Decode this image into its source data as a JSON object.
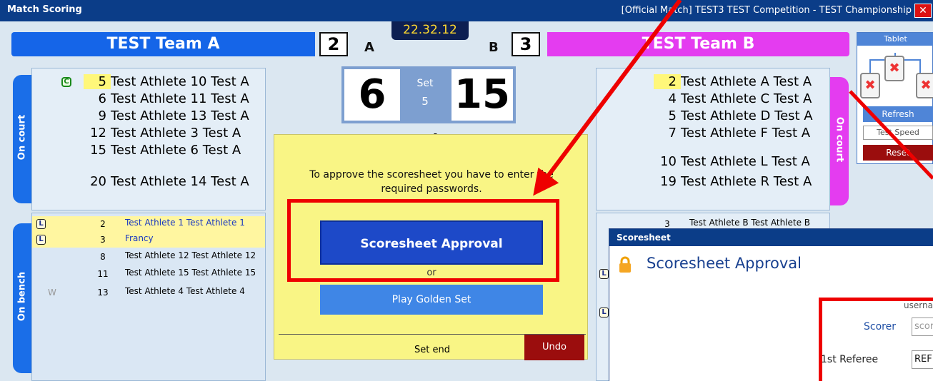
{
  "window": {
    "title": "Match Scoring",
    "match_info": "[Official Match] TEST3  TEST Competition - TEST Championship",
    "close_glyph": "✕"
  },
  "clock": "22.32.12",
  "teamA": {
    "name": "TEST Team A",
    "sets": "2",
    "side": "A"
  },
  "teamB": {
    "name": "TEST Team B",
    "sets": "3",
    "side": "B"
  },
  "set_score": {
    "pointsA": "6",
    "pointsB": "15",
    "label": "Set",
    "number": "5"
  },
  "separator_glyph": ":",
  "labels": {
    "on_court": "On court",
    "on_bench": "On bench"
  },
  "teamA_court": [
    {
      "num": "5",
      "name": "Test Athlete 10 Test A",
      "highlight": true
    },
    {
      "num": "6",
      "name": "Test Athlete 11 Test A"
    },
    {
      "num": "9",
      "name": "Test Athlete 13 Test A"
    },
    {
      "num": "12",
      "name": "Test Athlete 3 Test A"
    },
    {
      "num": "15",
      "name": "Test Athlete 6 Test A"
    },
    {
      "num": "20",
      "name": "Test Athlete 14 Test A"
    }
  ],
  "captain_glyph": "C",
  "teamA_bench": [
    {
      "libero": "L",
      "num": "2",
      "name": "Test Athlete 1 Test Athlete 1",
      "highlight": true
    },
    {
      "libero": "L",
      "num": "3",
      "name": "Francy",
      "highlight": true
    },
    {
      "num": "8",
      "name": "Test Athlete 12 Test Athlete 12"
    },
    {
      "num": "11",
      "name": "Test Athlete 15 Test Athlete 15"
    },
    {
      "num": "13",
      "name": "Test Athlete 4 Test Athlete 4",
      "mark": "W"
    }
  ],
  "teamB_court": [
    {
      "num": "2",
      "name": "Test Athlete A Test A",
      "highlight": true
    },
    {
      "num": "4",
      "name": "Test Athlete C Test A"
    },
    {
      "num": "5",
      "name": "Test Athlete D Test A"
    },
    {
      "num": "7",
      "name": "Test Athlete F Test A"
    },
    {
      "num": "10",
      "name": "Test Athlete L Test A"
    },
    {
      "num": "19",
      "name": "Test Athlete R Test A"
    }
  ],
  "teamB_bench_first": {
    "num": "3",
    "name": "Test Athlete B Test Athlete B"
  },
  "teamB_bench_libero": "L",
  "dialog": {
    "message": "To approve the scoresheet you have to enter the required passwords.",
    "approve_label": "Scoresheet Approval",
    "or_label": "or",
    "golden_label": "Play Golden Set"
  },
  "set_end": {
    "label": "Set end",
    "undo_label": "Undo"
  },
  "tablet": {
    "title": "Tablet",
    "refresh_label": "Refresh",
    "speed_label": "Test Speed",
    "reset_label": "Reset",
    "status_glyph": "✖"
  },
  "scoresheet": {
    "window_title": "Scoresheet",
    "heading": "Scoresheet Approval",
    "username_header": "username",
    "scorer_label": "Scorer",
    "scorer_placeholder": "scorer",
    "referee_label": "1st Referee",
    "referee_value": "REF"
  },
  "colors": {
    "title_bar": "#0b3d88",
    "teamA": "#1565e8",
    "teamB": "#e43cf0",
    "dialog_bg": "#f9f585",
    "approve_button": "#1d49c8",
    "undo_button": "#9b0d0d",
    "annotation": "#e00000"
  }
}
